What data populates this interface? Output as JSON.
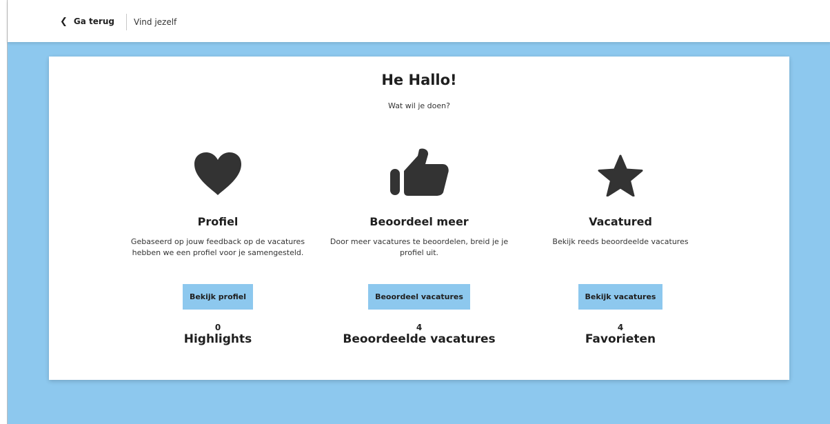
{
  "nav": {
    "back_label": "Ga terug",
    "back_icon": "chevron-left-icon",
    "breadcrumb": "Vind jezelf"
  },
  "header": {
    "title": "He Hallo!",
    "subtitle": "Wat wil je doen?"
  },
  "sections": [
    {
      "icon": "heart-icon",
      "title": "Profiel",
      "description": "Gebaseerd op jouw feedback op de vacatures hebben we een profiel voor je samengesteld.",
      "button": "Bekijk profiel",
      "stat_value": "0",
      "stat_label": "Highlights"
    },
    {
      "icon": "thumbs-up-icon",
      "title": "Beoordeel meer",
      "description": "Door meer vacatures te beoordelen, breid je je profiel uit.",
      "button": "Beoordeel vacatures",
      "stat_value": "4",
      "stat_label": "Beoordeelde vacatures"
    },
    {
      "icon": "star-icon",
      "title": "Vacatured",
      "description": "Bekijk reeds beoordeelde vacatures",
      "button": "Bekijk vacatures",
      "stat_value": "4",
      "stat_label": "Favorieten"
    }
  ],
  "colors": {
    "accent": "#8dc8ee",
    "icon": "#333333",
    "text": "#1f1f1f"
  }
}
